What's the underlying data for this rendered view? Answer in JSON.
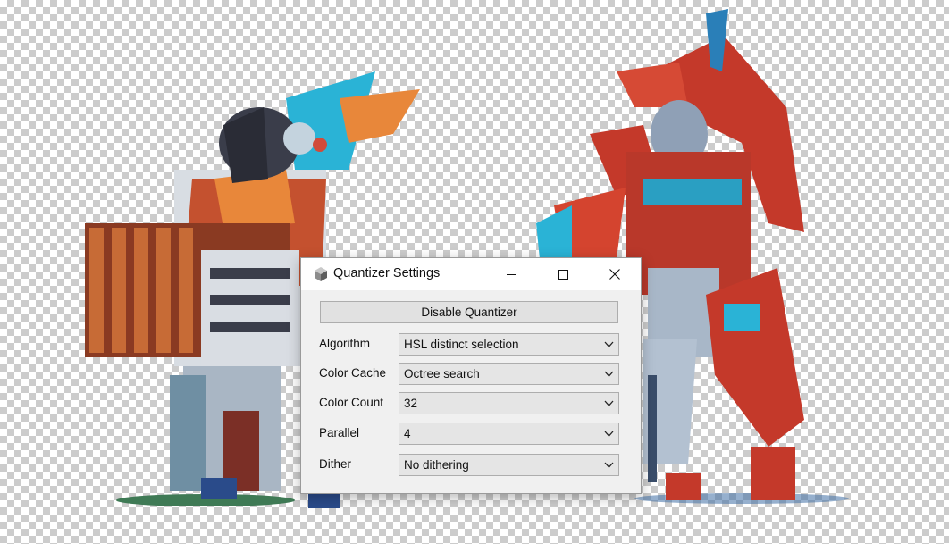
{
  "dialog": {
    "title": "Quantizer Settings",
    "app_icon": "cube-icon",
    "caption_buttons": [
      "minimize-icon",
      "maximize-icon",
      "close-icon"
    ],
    "disable_button_label": "Disable Quantizer",
    "settings": [
      {
        "label": "Algorithm",
        "value": "HSL distinct selection"
      },
      {
        "label": "Color Cache",
        "value": "Octree search"
      },
      {
        "label": "Color Count",
        "value": "32"
      },
      {
        "label": "Parallel",
        "value": "4"
      },
      {
        "label": "Dither",
        "value": "No dithering"
      }
    ]
  },
  "canvas": {
    "background": "transparency-checkerboard",
    "content": "pixel-art-characters",
    "colors": {
      "checker_light": "#ffffff",
      "checker_dark": "#cccccc",
      "accent_red": "#c43b2a",
      "accent_cyan": "#2ab3d6"
    }
  }
}
